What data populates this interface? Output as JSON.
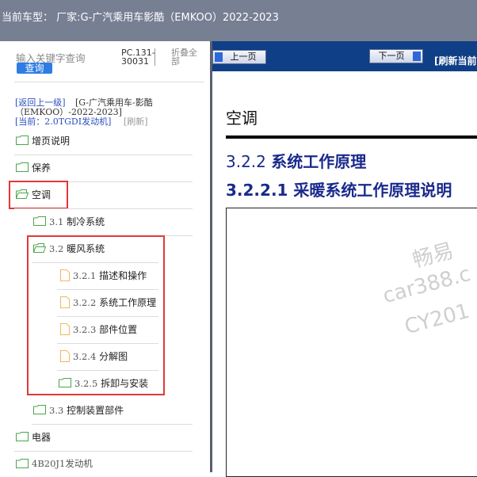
{
  "topbar": {
    "vehicle_label": "当前车型： 厂家:G-广汽乘用车影酷（EMKOO）2022-2023"
  },
  "search": {
    "placeholder": "输入关键字查询",
    "button": "查询"
  },
  "pc_code": "PC.131-30031",
  "collapse_all": "折叠全部",
  "breadcrumb": {
    "back": "[返回上一级]",
    "parent": "[G-广汽乘用车-影酷",
    "parent_cont": "（EMKOO）-2022-2023]",
    "current": "[当前：2.0TGDI发动机]",
    "refresh": "[刷新]"
  },
  "tree": [
    {
      "label": "增页说明",
      "icon": "folder-icon",
      "level": 0
    },
    {
      "label": "保养",
      "icon": "folder-icon",
      "level": 0
    },
    {
      "label": "空调",
      "icon": "folder-open-icon",
      "level": 0
    },
    {
      "num": "3.1",
      "label": "制冷系统",
      "icon": "folder-icon",
      "level": 1
    },
    {
      "num": "3.2",
      "label": "暖风系统",
      "icon": "folder-open-icon",
      "level": 1
    },
    {
      "num": "3.2.1",
      "label": "描述和操作",
      "icon": "page-icon",
      "level": 2
    },
    {
      "num": "3.2.2",
      "label": "系统工作原理",
      "icon": "page-icon",
      "level": 2
    },
    {
      "num": "3.2.3",
      "label": "部件位置",
      "icon": "page-icon",
      "level": 2
    },
    {
      "num": "3.2.4",
      "label": "分解图",
      "icon": "page-icon",
      "level": 2
    },
    {
      "num": "3.2.5",
      "label": "拆卸与安装",
      "icon": "folder-icon",
      "level": 2
    },
    {
      "num": "3.3",
      "label": "控制装置部件",
      "icon": "folder-icon",
      "level": 1
    },
    {
      "label": "电器",
      "icon": "folder-icon",
      "level": 0
    },
    {
      "label": "4B20J1发动机",
      "icon": "folder-icon",
      "level": 0
    }
  ],
  "nav": {
    "prev": "上一页",
    "next": "下一页",
    "refresh": "[刷新当前"
  },
  "content": {
    "section_title": "空调",
    "h2_num": "3.2.2",
    "h2_text": "系统工作原理",
    "h3": "3.2.2.1 采暖系统工作原理说明",
    "watermark_1": "畅易",
    "watermark_2": "car388.c",
    "watermark_3": "CY201"
  },
  "colors": {
    "topbar": "#777f93",
    "navbar": "#0f3f86",
    "highlight": "#e23838",
    "heading": "#1a2a8c",
    "folder": "#4aa64a",
    "page": "#f0b860"
  }
}
